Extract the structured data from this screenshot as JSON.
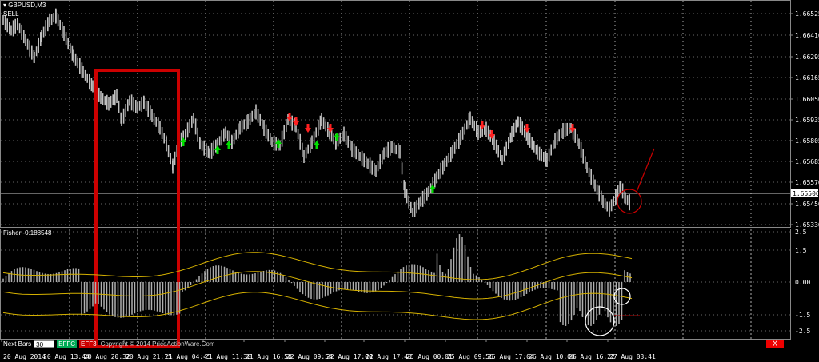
{
  "window": {
    "symbol_title": "GBPUSD,M3",
    "signal_label": "SELL"
  },
  "indicator": {
    "title": "Fisher -0.188548",
    "tick_labels": [
      "2.5",
      "1.5",
      "0.00",
      "-1.5",
      "-2.5"
    ]
  },
  "price_axis": {
    "labels": [
      "1.66525",
      "1.66410",
      "1.66295",
      "1.66165",
      "1.66050",
      "1.65935",
      "1.65805",
      "1.65685",
      "1.65570",
      "1.65450",
      "1.65330"
    ],
    "current_price": "1.65506"
  },
  "time_axis": {
    "labels": [
      "20 Aug 2014",
      "20 Aug 13:44",
      "20 Aug 20:32",
      "20 Aug 21:15",
      "21 Aug 04:45",
      "21 Aug 11:30",
      "21 Aug 16:50",
      "22 Aug 09:54",
      "22 Aug 17:00",
      "22 Aug 17:40",
      "25 Aug 00:01",
      "25 Aug 09:56",
      "25 Aug 17:04",
      "26 Aug 10:00",
      "26 Aug 16:22",
      "27 Aug 03:41"
    ]
  },
  "controls": {
    "label": "Next Bars",
    "input_value": "30",
    "btn1": "EFFC",
    "btn2": "EFF3",
    "copyright": "Copyright © 2014 PriceActionWare.Com",
    "close_label": "X"
  },
  "colors": {
    "background": "#000000",
    "candles": "#c0c0c0",
    "buy_arrow": "#00e000",
    "sell_arrow": "#ff2020",
    "highlight_box": "#cc0000",
    "bands": "#d4b000"
  },
  "icons": {
    "buy": "up-arrow-icon",
    "sell": "down-arrow-icon",
    "close": "close-icon",
    "menu": "triangle-down-icon"
  }
}
